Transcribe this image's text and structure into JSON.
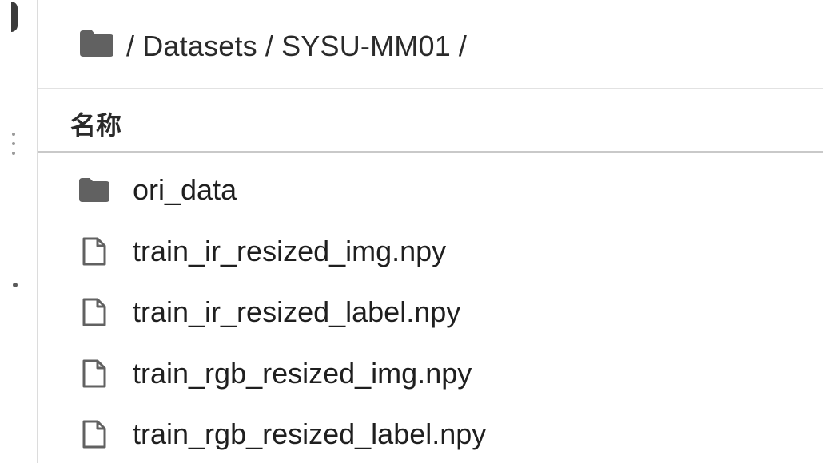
{
  "breadcrumb": {
    "root_sep": "/",
    "parts": [
      "Datasets",
      "SYSU-MM01"
    ],
    "sep": "/",
    "trailing_sep": "/"
  },
  "table": {
    "column_name": "名称"
  },
  "files": [
    {
      "name": "ori_data",
      "type": "folder",
      "icon": "folder-icon"
    },
    {
      "name": "train_ir_resized_img.npy",
      "type": "file",
      "icon": "file-icon"
    },
    {
      "name": "train_ir_resized_label.npy",
      "type": "file",
      "icon": "file-icon"
    },
    {
      "name": "train_rgb_resized_img.npy",
      "type": "file",
      "icon": "file-icon"
    },
    {
      "name": "train_rgb_resized_label.npy",
      "type": "file",
      "icon": "file-icon"
    }
  ],
  "colors": {
    "folder": "#616161",
    "file_outline": "#616161"
  }
}
